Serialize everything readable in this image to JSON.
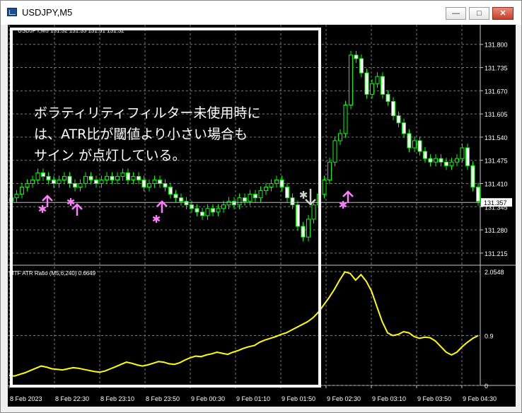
{
  "window": {
    "title": "USDJPY,M5",
    "minimize_glyph": "—",
    "maximize_glyph": "□",
    "close_glyph": "✕"
  },
  "main_panel": {
    "header": "USDJPY,M5  131.32 131.33 131.31 131.32",
    "price_labels": [
      "131.800",
      "131.735",
      "131.670",
      "131.605",
      "131.540",
      "131.475",
      "131.410",
      "131.345",
      "131.280",
      "131.215"
    ],
    "current_price": "131.357",
    "current_price_value": 131.357
  },
  "indicator_panel": {
    "header": "MTF ATR Ratio  (M5,6,240) 0.6649",
    "scale_labels": [
      "2.0548",
      "0.9",
      "0"
    ],
    "threshold": 0.9
  },
  "time_labels": [
    "8 Feb 2023",
    "8 Feb 22:30",
    "8 Feb 23:10",
    "8 Feb 23:50",
    "9 Feb 00:30",
    "9 Feb 01:10",
    "9 Feb 01:50",
    "9 Feb 02:30",
    "9 Feb 03:10",
    "9 Feb 03:50",
    "9 Feb 04:30"
  ],
  "annotation": {
    "lines": [
      "ボラティリティフィルター未使用時に",
      "は、ATR比が閾値より小さい場合も",
      "サイン が点灯している。"
    ]
  },
  "chart_data": {
    "type": "line",
    "candles": {
      "open": [
        131.36,
        131.37,
        131.38,
        131.4,
        131.41,
        131.42,
        131.44,
        131.43,
        131.42,
        131.41,
        131.42,
        131.43,
        131.41,
        131.4,
        131.41,
        131.43,
        131.42,
        131.41,
        131.42,
        131.43,
        131.42,
        131.43,
        131.44,
        131.42,
        131.43,
        131.42,
        131.4,
        131.41,
        131.42,
        131.41,
        131.4,
        131.38,
        131.37,
        131.36,
        131.35,
        131.34,
        131.33,
        131.32,
        131.34,
        131.33,
        131.34,
        131.35,
        131.36,
        131.35,
        131.37,
        131.36,
        131.38,
        131.37,
        131.39,
        131.4,
        131.41,
        131.42,
        131.4,
        131.37,
        131.35,
        131.29,
        131.26,
        131.31,
        131.35,
        131.38,
        131.42,
        131.47,
        131.53,
        131.55,
        131.63,
        131.77,
        131.76,
        131.72,
        131.66,
        131.69,
        131.71,
        131.66,
        131.64,
        131.6,
        131.58,
        131.55,
        131.51,
        131.53,
        131.5,
        131.48,
        131.47,
        131.48,
        131.47,
        131.46,
        131.47,
        131.48,
        131.51,
        131.46,
        131.4
      ],
      "close": [
        131.37,
        131.38,
        131.4,
        131.41,
        131.42,
        131.44,
        131.43,
        131.42,
        131.41,
        131.42,
        131.43,
        131.41,
        131.4,
        131.41,
        131.43,
        131.42,
        131.41,
        131.42,
        131.43,
        131.42,
        131.43,
        131.44,
        131.42,
        131.43,
        131.42,
        131.4,
        131.41,
        131.42,
        131.41,
        131.4,
        131.38,
        131.37,
        131.36,
        131.35,
        131.34,
        131.33,
        131.32,
        131.34,
        131.33,
        131.34,
        131.35,
        131.36,
        131.35,
        131.37,
        131.36,
        131.38,
        131.37,
        131.39,
        131.4,
        131.41,
        131.42,
        131.4,
        131.37,
        131.35,
        131.29,
        131.26,
        131.31,
        131.35,
        131.38,
        131.42,
        131.47,
        131.53,
        131.55,
        131.63,
        131.77,
        131.76,
        131.72,
        131.66,
        131.69,
        131.71,
        131.66,
        131.64,
        131.6,
        131.58,
        131.55,
        131.51,
        131.53,
        131.5,
        131.48,
        131.47,
        131.48,
        131.47,
        131.46,
        131.47,
        131.48,
        131.51,
        131.46,
        131.4,
        131.36
      ]
    },
    "atr_ratio": [
      0.18,
      0.17,
      0.2,
      0.23,
      0.27,
      0.31,
      0.35,
      0.33,
      0.3,
      0.29,
      0.28,
      0.3,
      0.32,
      0.31,
      0.29,
      0.27,
      0.25,
      0.24,
      0.26,
      0.3,
      0.34,
      0.38,
      0.42,
      0.4,
      0.37,
      0.35,
      0.37,
      0.4,
      0.43,
      0.42,
      0.39,
      0.38,
      0.41,
      0.46,
      0.5,
      0.53,
      0.52,
      0.55,
      0.57,
      0.6,
      0.58,
      0.56,
      0.6,
      0.63,
      0.67,
      0.7,
      0.72,
      0.78,
      0.82,
      0.85,
      0.88,
      0.92,
      0.95,
      1.0,
      1.05,
      1.1,
      1.15,
      1.22,
      1.32,
      1.45,
      1.58,
      1.73,
      1.9,
      2.05,
      2.02,
      1.9,
      2.0,
      1.88,
      1.7,
      1.42,
      1.15,
      0.95,
      0.9,
      0.92,
      0.97,
      0.95,
      0.88,
      0.85,
      0.87,
      0.86,
      0.8,
      0.7,
      0.6,
      0.55,
      0.6,
      0.7,
      0.78,
      0.85,
      0.9
    ]
  }
}
